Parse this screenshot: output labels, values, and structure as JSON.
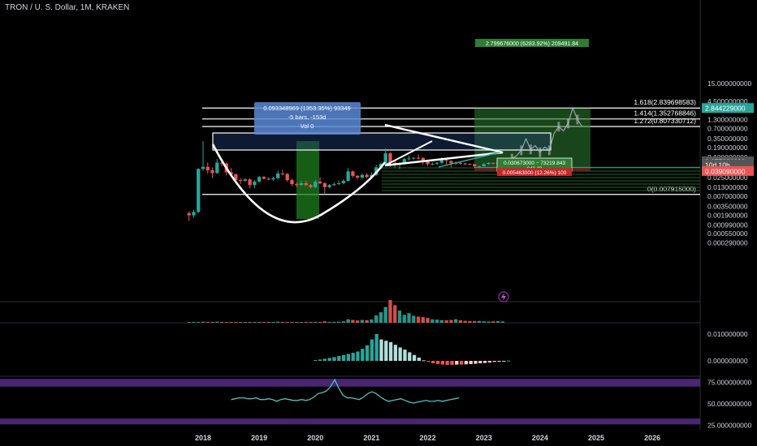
{
  "header": {
    "title": "TRON / U. S. Dollar, 1M, KRAKEN"
  },
  "colors": {
    "bg": "#000000",
    "up": "#26a69a",
    "down": "#ef5350",
    "grid": "#1b1b1b",
    "axis_text": "#d1d4dc",
    "white": "#ffffff",
    "profit": "#1b5e20",
    "loss": "#7f0000",
    "rsi": "#4fc3c1",
    "rsi_band": "#5b2f8f"
  },
  "icons": {
    "lightning": "lightning-icon"
  },
  "chart_data": [
    {
      "type": "candlestick",
      "title": "TRON / U. S. Dollar, 1M, KRAKEN",
      "scale": "log",
      "ylim": [
        0.0004,
        15
      ],
      "x_ticks": [
        "2018",
        "2019",
        "2020",
        "2021",
        "2022",
        "2023",
        "2024",
        "2025",
        "2026"
      ],
      "y_ticks": [
        "15.000000000",
        "4.500000000",
        "2.500000000",
        "1.300000000",
        "0.700000000",
        "0.350000000",
        "0.190000000",
        "0.100000000",
        "0.045553000",
        "0.025000000",
        "0.013000000",
        "0.007000000",
        "0.003500000",
        "0.001900000",
        "0.000990000",
        "0.000550000",
        "0.000290000"
      ],
      "price_badges": [
        {
          "label": "2.844229000",
          "value": 2.844229,
          "color": "#26a69a"
        },
        {
          "label": "0.075226000",
          "value": 0.075226,
          "color": "#555555"
        },
        {
          "label": "10d 10h",
          "value": 0.0605,
          "color": "#555555"
        },
        {
          "label": "0.039090000",
          "value": 0.03909,
          "color": "#ef5350"
        }
      ],
      "fib_levels": [
        {
          "label": "1.618(2.839698583)",
          "value": 2.839698583
        },
        {
          "label": "1.414(1.352768846)",
          "value": 1.352768846
        },
        {
          "label": "1.272(0.807330712)",
          "value": 0.807330712
        },
        {
          "label": "0(0.007915000)",
          "value": 0.007915
        }
      ],
      "annotations": {
        "measure": [
          "0.093348969 (1353.35%) 93349",
          "-5 bars, -153d",
          "Vol 0"
        ],
        "target": "2.799676000 (6283.92%) 209491.84",
        "stop": "0.030673000 − 73219.843",
        "stop_sub": "842.48",
        "loss": "0.005463000 (12.26%) 100"
      },
      "candles": [
        {
          "t": "2017-10",
          "o": 0.0022,
          "h": 0.0025,
          "l": 0.0013,
          "c": 0.0019
        },
        {
          "t": "2017-11",
          "o": 0.0019,
          "h": 0.0028,
          "l": 0.0016,
          "c": 0.0024
        },
        {
          "t": "2017-12",
          "o": 0.0024,
          "h": 0.047,
          "l": 0.0022,
          "c": 0.045
        },
        {
          "t": "2018-01",
          "o": 0.045,
          "h": 0.3,
          "l": 0.04,
          "c": 0.052
        },
        {
          "t": "2018-02",
          "o": 0.052,
          "h": 0.07,
          "l": 0.032,
          "c": 0.041
        },
        {
          "t": "2018-03",
          "o": 0.041,
          "h": 0.05,
          "l": 0.024,
          "c": 0.034
        },
        {
          "t": "2018-04",
          "o": 0.034,
          "h": 0.088,
          "l": 0.032,
          "c": 0.069
        },
        {
          "t": "2018-05",
          "o": 0.069,
          "h": 0.09,
          "l": 0.055,
          "c": 0.065
        },
        {
          "t": "2018-06",
          "o": 0.065,
          "h": 0.07,
          "l": 0.029,
          "c": 0.036
        },
        {
          "t": "2018-07",
          "o": 0.036,
          "h": 0.048,
          "l": 0.03,
          "c": 0.031
        },
        {
          "t": "2018-08",
          "o": 0.031,
          "h": 0.033,
          "l": 0.019,
          "c": 0.021
        },
        {
          "t": "2018-09",
          "o": 0.021,
          "h": 0.024,
          "l": 0.016,
          "c": 0.02
        },
        {
          "t": "2018-10",
          "o": 0.02,
          "h": 0.024,
          "l": 0.019,
          "c": 0.022
        },
        {
          "t": "2018-11",
          "o": 0.022,
          "h": 0.024,
          "l": 0.012,
          "c": 0.015
        },
        {
          "t": "2018-12",
          "o": 0.015,
          "h": 0.021,
          "l": 0.012,
          "c": 0.019
        },
        {
          "t": "2019-01",
          "o": 0.019,
          "h": 0.028,
          "l": 0.018,
          "c": 0.026
        },
        {
          "t": "2019-02",
          "o": 0.026,
          "h": 0.028,
          "l": 0.022,
          "c": 0.023
        },
        {
          "t": "2019-03",
          "o": 0.023,
          "h": 0.025,
          "l": 0.021,
          "c": 0.022
        },
        {
          "t": "2019-04",
          "o": 0.022,
          "h": 0.027,
          "l": 0.02,
          "c": 0.024
        },
        {
          "t": "2019-05",
          "o": 0.024,
          "h": 0.04,
          "l": 0.022,
          "c": 0.033
        },
        {
          "t": "2019-06",
          "o": 0.033,
          "h": 0.042,
          "l": 0.029,
          "c": 0.032
        },
        {
          "t": "2019-07",
          "o": 0.032,
          "h": 0.034,
          "l": 0.019,
          "c": 0.021
        },
        {
          "t": "2019-08",
          "o": 0.021,
          "h": 0.023,
          "l": 0.014,
          "c": 0.016
        },
        {
          "t": "2019-09",
          "o": 0.016,
          "h": 0.018,
          "l": 0.013,
          "c": 0.015
        },
        {
          "t": "2019-10",
          "o": 0.015,
          "h": 0.02,
          "l": 0.014,
          "c": 0.017
        },
        {
          "t": "2019-11",
          "o": 0.017,
          "h": 0.02,
          "l": 0.014,
          "c": 0.015
        },
        {
          "t": "2019-12",
          "o": 0.015,
          "h": 0.016,
          "l": 0.012,
          "c": 0.013
        },
        {
          "t": "2020-01",
          "o": 0.013,
          "h": 0.021,
          "l": 0.012,
          "c": 0.019
        },
        {
          "t": "2020-02",
          "o": 0.019,
          "h": 0.025,
          "l": 0.016,
          "c": 0.017
        },
        {
          "t": "2020-03",
          "o": 0.017,
          "h": 0.018,
          "l": 0.008,
          "c": 0.013
        },
        {
          "t": "2020-04",
          "o": 0.013,
          "h": 0.016,
          "l": 0.012,
          "c": 0.015
        },
        {
          "t": "2020-05",
          "o": 0.015,
          "h": 0.018,
          "l": 0.014,
          "c": 0.016
        },
        {
          "t": "2020-06",
          "o": 0.016,
          "h": 0.02,
          "l": 0.015,
          "c": 0.017
        },
        {
          "t": "2020-07",
          "o": 0.017,
          "h": 0.022,
          "l": 0.016,
          "c": 0.02
        },
        {
          "t": "2020-08",
          "o": 0.02,
          "h": 0.048,
          "l": 0.019,
          "c": 0.038
        },
        {
          "t": "2020-09",
          "o": 0.038,
          "h": 0.04,
          "l": 0.025,
          "c": 0.028
        },
        {
          "t": "2020-10",
          "o": 0.028,
          "h": 0.03,
          "l": 0.023,
          "c": 0.025
        },
        {
          "t": "2020-11",
          "o": 0.025,
          "h": 0.033,
          "l": 0.023,
          "c": 0.03
        },
        {
          "t": "2020-12",
          "o": 0.03,
          "h": 0.034,
          "l": 0.024,
          "c": 0.026
        },
        {
          "t": "2021-01",
          "o": 0.026,
          "h": 0.035,
          "l": 0.024,
          "c": 0.03
        },
        {
          "t": "2021-02",
          "o": 0.03,
          "h": 0.06,
          "l": 0.028,
          "c": 0.05
        },
        {
          "t": "2021-03",
          "o": 0.05,
          "h": 0.07,
          "l": 0.045,
          "c": 0.064
        },
        {
          "t": "2021-04",
          "o": 0.064,
          "h": 0.18,
          "l": 0.06,
          "c": 0.13
        },
        {
          "t": "2021-05",
          "o": 0.13,
          "h": 0.14,
          "l": 0.052,
          "c": 0.068
        },
        {
          "t": "2021-06",
          "o": 0.068,
          "h": 0.085,
          "l": 0.05,
          "c": 0.062
        },
        {
          "t": "2021-07",
          "o": 0.062,
          "h": 0.07,
          "l": 0.045,
          "c": 0.062
        },
        {
          "t": "2021-08",
          "o": 0.062,
          "h": 0.095,
          "l": 0.06,
          "c": 0.088
        },
        {
          "t": "2021-09",
          "o": 0.088,
          "h": 0.11,
          "l": 0.08,
          "c": 0.092
        },
        {
          "t": "2021-10",
          "o": 0.092,
          "h": 0.1,
          "l": 0.085,
          "c": 0.096
        },
        {
          "t": "2021-11",
          "o": 0.096,
          "h": 0.12,
          "l": 0.085,
          "c": 0.095
        },
        {
          "t": "2021-12",
          "o": 0.095,
          "h": 0.1,
          "l": 0.06,
          "c": 0.075
        },
        {
          "t": "2022-01",
          "o": 0.075,
          "h": 0.08,
          "l": 0.055,
          "c": 0.062
        },
        {
          "t": "2022-02",
          "o": 0.062,
          "h": 0.07,
          "l": 0.058,
          "c": 0.064
        },
        {
          "t": "2022-03",
          "o": 0.064,
          "h": 0.072,
          "l": 0.058,
          "c": 0.068
        },
        {
          "t": "2022-04",
          "o": 0.068,
          "h": 0.1,
          "l": 0.062,
          "c": 0.082
        },
        {
          "t": "2022-05",
          "o": 0.082,
          "h": 0.09,
          "l": 0.055,
          "c": 0.077
        },
        {
          "t": "2022-06",
          "o": 0.077,
          "h": 0.08,
          "l": 0.05,
          "c": 0.066
        },
        {
          "t": "2022-07",
          "o": 0.066,
          "h": 0.075,
          "l": 0.06,
          "c": 0.068
        },
        {
          "t": "2022-08",
          "o": 0.068,
          "h": 0.075,
          "l": 0.06,
          "c": 0.065
        },
        {
          "t": "2022-09",
          "o": 0.065,
          "h": 0.068,
          "l": 0.058,
          "c": 0.063
        },
        {
          "t": "2022-10",
          "o": 0.063,
          "h": 0.066,
          "l": 0.06,
          "c": 0.062
        },
        {
          "t": "2022-11",
          "o": 0.062,
          "h": 0.064,
          "l": 0.048,
          "c": 0.054
        },
        {
          "t": "2022-12",
          "o": 0.054,
          "h": 0.056,
          "l": 0.051,
          "c": 0.054
        },
        {
          "t": "2023-01",
          "o": 0.054,
          "h": 0.066,
          "l": 0.053,
          "c": 0.063
        },
        {
          "t": "2023-02",
          "o": 0.063,
          "h": 0.071,
          "l": 0.06,
          "c": 0.068
        },
        {
          "t": "2023-03",
          "o": 0.068,
          "h": 0.07,
          "l": 0.061,
          "c": 0.065
        },
        {
          "t": "2023-04",
          "o": 0.065,
          "h": 0.08,
          "l": 0.062,
          "c": 0.068
        },
        {
          "t": "2023-05",
          "o": 0.068,
          "h": 0.08,
          "l": 0.067,
          "c": 0.075
        }
      ],
      "projection": [
        {
          "t": "2023-07",
          "v": 0.09
        },
        {
          "t": "2023-08",
          "v": 0.11
        },
        {
          "t": "2023-09",
          "v": 0.16
        },
        {
          "t": "2023-10",
          "v": 0.35
        },
        {
          "t": "2023-11",
          "v": 0.17
        },
        {
          "t": "2023-12",
          "v": 0.22
        },
        {
          "t": "2024-01",
          "v": 0.14
        },
        {
          "t": "2024-02",
          "v": 0.2
        },
        {
          "t": "2024-03",
          "v": 0.16
        },
        {
          "t": "2024-04",
          "v": 0.5
        },
        {
          "t": "2024-05",
          "v": 0.8
        },
        {
          "t": "2024-06",
          "v": 0.6
        },
        {
          "t": "2024-07",
          "v": 1.0
        },
        {
          "t": "2024-08",
          "v": 2.84
        },
        {
          "t": "2024-09",
          "v": 1.3
        },
        {
          "t": "2024-10",
          "v": 0.8
        }
      ]
    },
    {
      "type": "bar",
      "title": "",
      "values": [
        0.1,
        0.1,
        0.3,
        0.6,
        0.5,
        0.4,
        0.6,
        0.5,
        0.4,
        0.3,
        0.3,
        0.2,
        0.2,
        0.3,
        0.2,
        0.3,
        0.3,
        0.3,
        0.3,
        0.6,
        0.5,
        0.4,
        0.3,
        0.3,
        0.3,
        0.3,
        0.3,
        0.5,
        0.5,
        0.8,
        0.5,
        0.5,
        0.6,
        0.8,
        2.0,
        1.6,
        1.3,
        1.6,
        1.5,
        1.9,
        4.2,
        6.0,
        9.0,
        13.0,
        10.0,
        7.0,
        4.5,
        5.5,
        4.0,
        3.5,
        3.2,
        2.8,
        2.0,
        1.8,
        1.5,
        1.4,
        1.6,
        2.0,
        1.4,
        1.1,
        1.0,
        0.9,
        1.0,
        0.8,
        0.7,
        0.8,
        0.9,
        0.8,
        0.7
      ]
    },
    {
      "type": "bar",
      "title": "",
      "y_ticks": [
        "0.010000000",
        "0.000000000"
      ],
      "values": [
        0.0003,
        0.0005,
        0.0008,
        0.0011,
        0.0014,
        0.0018,
        0.0022,
        0.0026,
        0.003,
        0.0035,
        0.0045,
        0.0058,
        0.008,
        0.01,
        0.008,
        0.0075,
        0.007,
        0.006,
        0.005,
        0.0042,
        0.0032,
        0.0022,
        0.0012,
        0.0002,
        -0.0004,
        -0.0009,
        -0.0012,
        -0.0014,
        -0.0015,
        -0.0015,
        -0.0014,
        -0.0014,
        -0.0013,
        -0.0012,
        -0.0011,
        -0.0009,
        -0.0008,
        -0.0006,
        -0.0004,
        -0.0002,
        -0.0001,
        0.0001
      ]
    },
    {
      "type": "line",
      "title": "",
      "y_ticks": [
        "75.000000000",
        "50.000000000",
        "25.000000000"
      ],
      "ylim": [
        20,
        82
      ],
      "bands": [
        70,
        30
      ],
      "values": [
        55,
        56,
        57,
        57,
        56,
        56,
        57,
        55,
        55,
        56,
        55,
        53,
        55,
        56,
        55,
        54,
        54,
        55,
        54,
        55,
        58,
        62,
        63,
        65,
        70,
        78,
        68,
        60,
        57,
        57,
        56,
        55,
        58,
        62,
        64,
        62,
        58,
        55,
        53,
        54,
        55,
        56,
        54,
        52,
        51,
        52,
        53,
        54,
        53,
        53,
        54,
        53,
        54,
        55,
        56,
        57
      ]
    }
  ]
}
